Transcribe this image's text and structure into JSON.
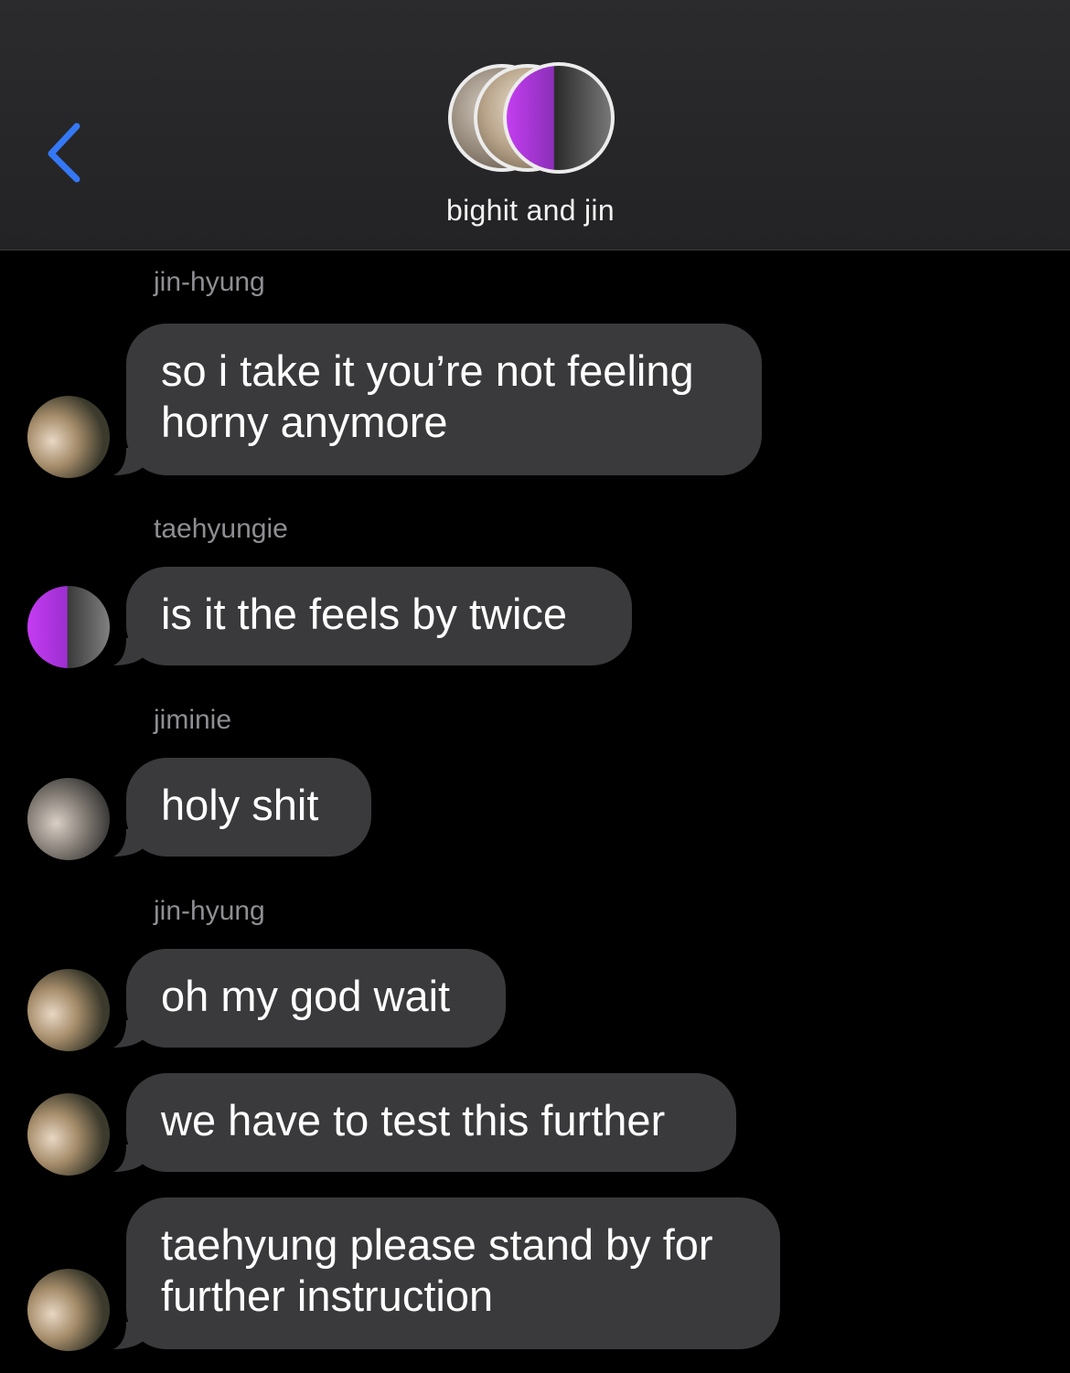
{
  "header": {
    "back_icon": "chevron-left-icon",
    "group_name": "bighit and jin",
    "accent_color": "#3478f6"
  },
  "messages": [
    {
      "sender": "jin-hyung",
      "lines": [
        "so i take it you’re not feeling",
        "horny anymore"
      ],
      "avatar": "jin"
    },
    {
      "sender": "taehyungie",
      "lines": [
        "is it the feels by twice"
      ],
      "avatar": "tae"
    },
    {
      "sender": "jiminie",
      "lines": [
        "holy shit"
      ],
      "avatar": "jim"
    },
    {
      "sender": "jin-hyung",
      "lines": [
        "oh my god wait"
      ],
      "avatar": "jin"
    },
    {
      "sender": "",
      "lines": [
        "we have to test this further"
      ],
      "avatar": "jin"
    },
    {
      "sender": "",
      "lines": [
        "taehyung please stand by for",
        "further instruction"
      ],
      "avatar": "jin"
    }
  ]
}
